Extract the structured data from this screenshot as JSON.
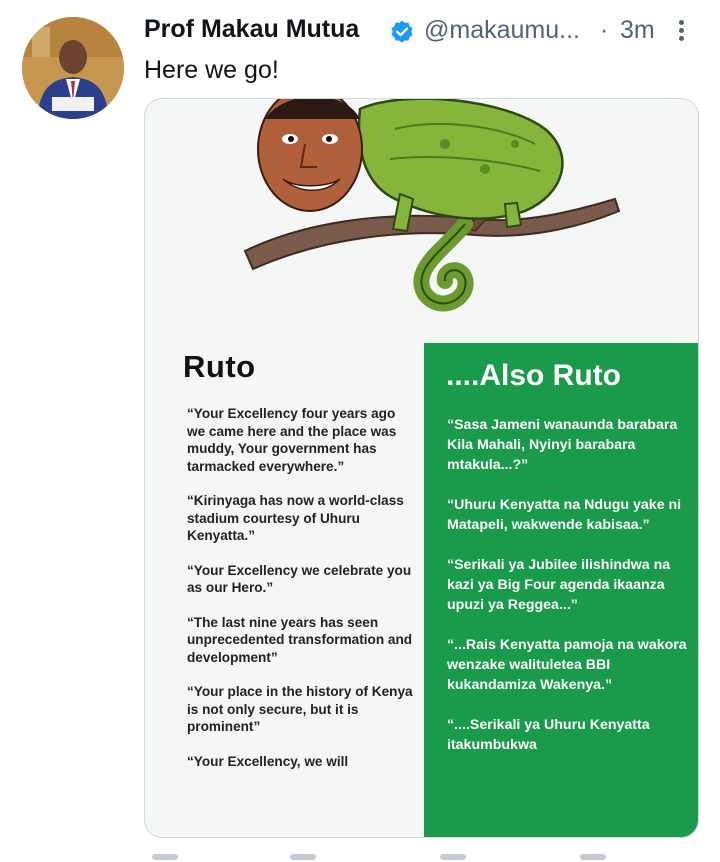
{
  "author": {
    "name": "Prof Makau Mutua",
    "handle": "@makaumu...",
    "separator": "·",
    "time": "3m",
    "verified": true
  },
  "tweet": {
    "text": "Here we go!"
  },
  "image": {
    "left": {
      "title": "Ruto",
      "quotes": [
        "“Your Excellency four years ago we came here and the place was muddy, Your government has tarmacked everywhere.”",
        "“Kirinyaga has now a world-class stadium courtesy of Uhuru Kenyatta.”",
        "“Your Excellency we celebrate you as our Hero.”",
        "“The last nine years has seen unprecedented transformation and development”",
        "“Your place in the history of Kenya is not only secure, but it is prominent”",
        "“Your Excellency, we will"
      ]
    },
    "right": {
      "title": "....Also Ruto",
      "quotes": [
        "“Sasa Jameni wanaunda barabara Kila Mahali, Nyinyi barabara mtakula...?”",
        "“Uhuru Kenyatta na Ndugu yake ni Matapeli, wakwende kabisaa.”",
        "“Serikali ya Jubilee ilishindwa na kazi ya Big Four agenda ikaanza upuzi ya Reggea...”",
        "“...Rais Kenyatta pamoja na wakora wenzake walituletea BBI kukandamiza Wakenya.”",
        "“....Serikali ya Uhuru Kenyatta itakumbukwa"
      ]
    }
  },
  "colors": {
    "green_panel": "#1a9a4b",
    "verified_blue": "#1d9bf0",
    "secondary_text": "#536471"
  }
}
